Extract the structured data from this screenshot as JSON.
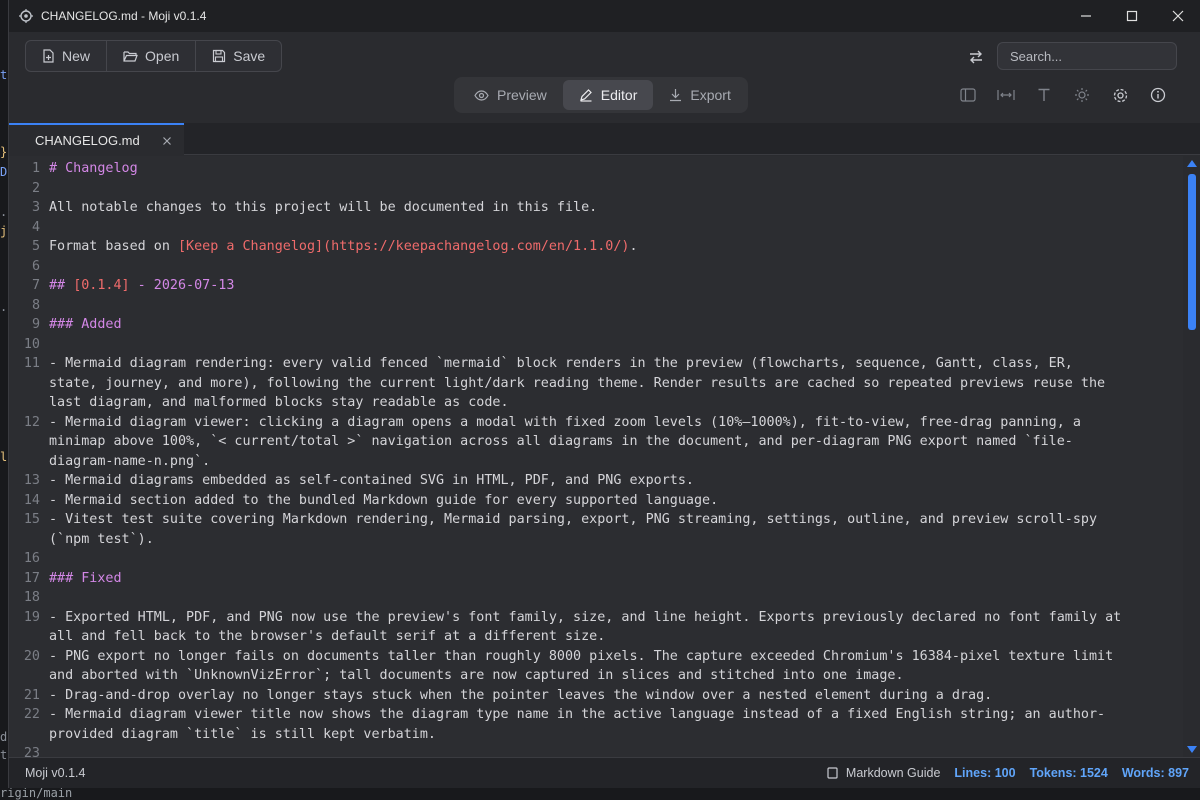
{
  "window": {
    "title": "CHANGELOG.md - Moji v0.1.4"
  },
  "toolbar": {
    "new_label": "New",
    "open_label": "Open",
    "save_label": "Save",
    "search_placeholder": "Search..."
  },
  "modes": {
    "preview": "Preview",
    "editor": "Editor",
    "export": "Export",
    "active": "editor"
  },
  "tab": {
    "name": "CHANGELOG.md"
  },
  "editor_lines": [
    {
      "n": "1",
      "segs": [
        {
          "t": "# Changelog",
          "c": "h"
        }
      ]
    },
    {
      "n": "2",
      "segs": []
    },
    {
      "n": "3",
      "segs": [
        {
          "t": "All notable changes to this project will be documented in this file."
        }
      ]
    },
    {
      "n": "4",
      "segs": []
    },
    {
      "n": "5",
      "segs": [
        {
          "t": "Format based on "
        },
        {
          "t": "[Keep a Changelog](https://keepachangelog.com/en/1.1.0/)",
          "c": "lk"
        },
        {
          "t": "."
        }
      ]
    },
    {
      "n": "6",
      "segs": []
    },
    {
      "n": "7",
      "segs": [
        {
          "t": "## ",
          "c": "h"
        },
        {
          "t": "[0.1.4]",
          "c": "lk"
        },
        {
          "t": " - 2026-07-13",
          "c": "h"
        }
      ]
    },
    {
      "n": "8",
      "segs": []
    },
    {
      "n": "9",
      "segs": [
        {
          "t": "### Added",
          "c": "h"
        }
      ]
    },
    {
      "n": "10",
      "segs": []
    },
    {
      "n": "11",
      "segs": [
        {
          "t": "- Mermaid diagram rendering: every valid fenced `mermaid` block renders in the preview (flowcharts, sequence, Gantt, class, ER,"
        }
      ]
    },
    {
      "n": "",
      "segs": [
        {
          "t": "state, journey, and more), following the current light/dark reading theme. Render results are cached so repeated previews reuse the"
        }
      ]
    },
    {
      "n": "",
      "segs": [
        {
          "t": "last diagram, and malformed blocks stay readable as code."
        }
      ]
    },
    {
      "n": "12",
      "segs": [
        {
          "t": "- Mermaid diagram viewer: clicking a diagram opens a modal with fixed zoom levels (10%–1000%), fit-to-view, free-drag panning, a"
        }
      ]
    },
    {
      "n": "",
      "segs": [
        {
          "t": "minimap above 100%, `< current/total >` navigation across all diagrams in the document, and per-diagram PNG export named `file-"
        }
      ]
    },
    {
      "n": "",
      "segs": [
        {
          "t": "diagram-name-n.png`."
        }
      ]
    },
    {
      "n": "13",
      "segs": [
        {
          "t": "- Mermaid diagrams embedded as self-contained SVG in HTML, PDF, and PNG exports."
        }
      ]
    },
    {
      "n": "14",
      "segs": [
        {
          "t": "- Mermaid section added to the bundled Markdown guide for every supported language."
        }
      ]
    },
    {
      "n": "15",
      "segs": [
        {
          "t": "- Vitest test suite covering Markdown rendering, Mermaid parsing, export, PNG streaming, settings, outline, and preview scroll-spy"
        }
      ]
    },
    {
      "n": "",
      "segs": [
        {
          "t": "(`npm test`)."
        }
      ]
    },
    {
      "n": "16",
      "segs": []
    },
    {
      "n": "17",
      "segs": [
        {
          "t": "### Fixed",
          "c": "h"
        }
      ]
    },
    {
      "n": "18",
      "segs": []
    },
    {
      "n": "19",
      "segs": [
        {
          "t": "- Exported HTML, PDF, and PNG now use the preview's font family, size, and line height. Exports previously declared no font family at"
        }
      ]
    },
    {
      "n": "",
      "segs": [
        {
          "t": "all and fell back to the browser's default serif at a different size."
        }
      ]
    },
    {
      "n": "20",
      "segs": [
        {
          "t": "- PNG export no longer fails on documents taller than roughly 8000 pixels. The capture exceeded Chromium's 16384-pixel texture limit"
        }
      ]
    },
    {
      "n": "",
      "segs": [
        {
          "t": "and aborted with `UnknownVizError`; tall documents are now captured in slices and stitched into one image."
        }
      ]
    },
    {
      "n": "21",
      "segs": [
        {
          "t": "- Drag-and-drop overlay no longer stays stuck when the pointer leaves the window over a nested element during a drag."
        }
      ]
    },
    {
      "n": "22",
      "segs": [
        {
          "t": "- Mermaid diagram viewer title now shows the diagram type name in the active language instead of a fixed English string; an author-"
        }
      ]
    },
    {
      "n": "",
      "segs": [
        {
          "t": "provided diagram `title` is still kept verbatim."
        }
      ]
    },
    {
      "n": "23",
      "segs": []
    }
  ],
  "status": {
    "version": "Moji v0.1.4",
    "guide": "Markdown Guide",
    "lines": "Lines: 100",
    "tokens": "Tokens: 1524",
    "words": "Words: 897"
  },
  "backdrop": {
    "bottom_text": "rigin/main"
  },
  "colors": {
    "accent": "#3b82f6",
    "heading": "#d387e6",
    "link": "#ef6b6b",
    "stat": "#60a5fa"
  }
}
